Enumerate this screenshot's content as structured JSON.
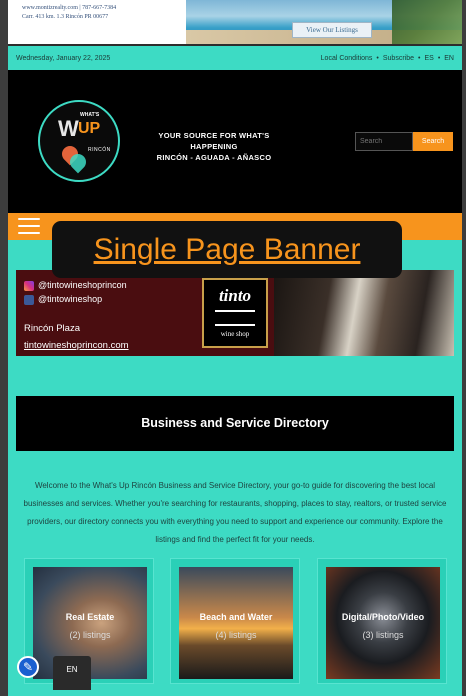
{
  "top_ad": {
    "agency_line1": "www.montizrealty.com | 787-667-7384",
    "agency_line2": "Carr. 413 km. 1.3 Rincón PR 00677",
    "listings_button": "View Our Listings"
  },
  "utility_bar": {
    "date": "Wednesday, January 22, 2025",
    "links": [
      "Local Conditions",
      "Subscribe",
      "ES",
      "EN"
    ],
    "separator": "•"
  },
  "header": {
    "logo": {
      "whats": "WHAT'S",
      "w": "W",
      "up": "UP",
      "place": "RINCÓN"
    },
    "tagline_line1": "YOUR SOURCE FOR WHAT'S HAPPENING",
    "tagline_line2": "RINCÓN - AGUADA - AÑASCO",
    "search": {
      "placeholder": "Search",
      "button": "Search"
    }
  },
  "nav": {
    "menu_icon": "hamburger-icon"
  },
  "tooltip": {
    "text": "Single Page Banner"
  },
  "banner": {
    "instagram": "@tintowineshoprincon",
    "facebook": "@tintowineshop",
    "location": "Rincón Plaza",
    "website": "tintowineshoprincon.com",
    "logo_name": "tinto",
    "logo_sub": "wine shop"
  },
  "directory": {
    "heading": "Business and Service Directory",
    "intro": "Welcome to the What's Up Rincón Business and Service Directory, your go-to guide for discovering the best local businesses and services. Whether you're searching for restaurants, shopping, places to stay, realtors, or trusted service providers, our directory connects you with everything you need to support and experience our community. Explore the listings and find the perfect fit for your needs.",
    "categories": [
      {
        "title": "Real Estate",
        "count": "(2) listings"
      },
      {
        "title": "Beach and Water",
        "count": "(4) listings"
      },
      {
        "title": "Digital/Photo/Video",
        "count": "(3) listings"
      }
    ]
  },
  "widgets": {
    "accessibility_icon": "accessibility-icon",
    "language": "EN"
  },
  "colors": {
    "accent": "#f7941d",
    "teal": "#3ddbc4",
    "header_bg": "#000000",
    "banner_bg": "#4a0d10"
  }
}
